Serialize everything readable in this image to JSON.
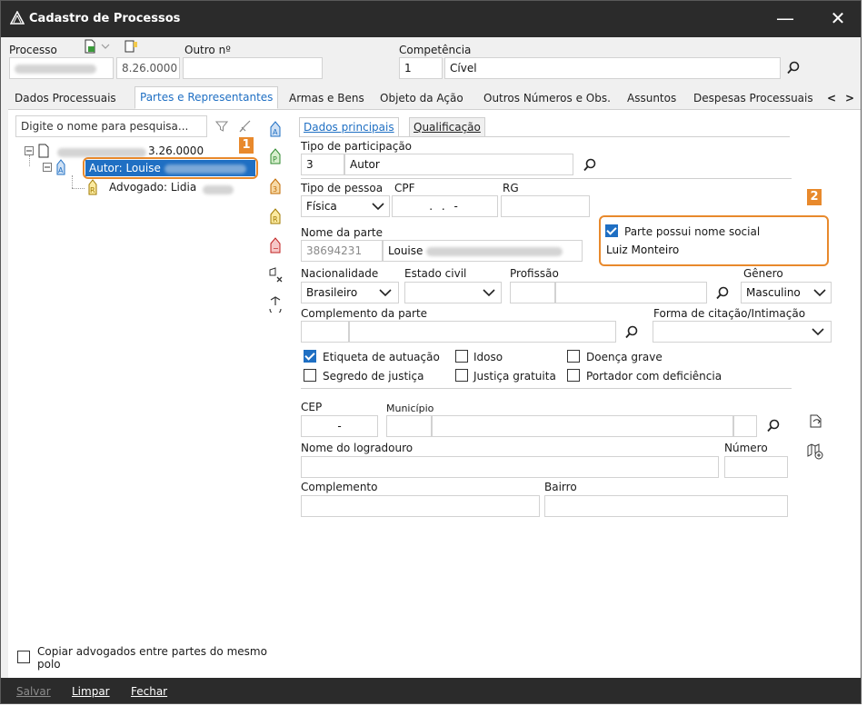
{
  "window": {
    "title": "Cadastro de Processos",
    "minimize": "—",
    "close": "✕"
  },
  "header": {
    "processo_label": "Processo",
    "processo_suffix": "8.26.0000",
    "outro_label": "Outro nº",
    "outro_value": "",
    "competencia_label": "Competência",
    "competencia_code": "1",
    "competencia_value": "Cível"
  },
  "tabs": [
    "Dados Processuais",
    "Partes e Representantes",
    "Armas e Bens",
    "Objeto da Ação",
    "Outros Números e Obs.",
    "Assuntos",
    "Despesas Processuais"
  ],
  "tab_nav": {
    "prev": "<",
    "next": ">"
  },
  "left": {
    "search_placeholder": "Digite o nome para pesquisa...",
    "tree_root_suffix": "3.26.0000",
    "tree_autor": "Autor: Louise",
    "tree_advogado": "Advogado: Lidia",
    "badge1": "1",
    "copy_checkbox_label": "Copiar advogados entre partes do mesmo polo",
    "copy_checked": false
  },
  "subtabs": {
    "dados_principais": "Dados principais",
    "qualificacao": "Qualificação"
  },
  "form": {
    "tipo_participacao_label": "Tipo de participação",
    "tipo_participacao_code": "3",
    "tipo_participacao_value": "Autor",
    "tipo_pessoa_label": "Tipo de pessoa",
    "tipo_pessoa_value": "Física",
    "cpf_label": "CPF",
    "cpf_value": ". . -",
    "rg_label": "RG",
    "rg_value": "",
    "nome_parte_label": "Nome da parte",
    "nome_parte_code": "38694231",
    "nome_parte_value": "Louise",
    "badge2": "2",
    "nome_social_checkbox_label": "Parte possui nome social",
    "nome_social_checked": true,
    "nome_social_value": "Luiz Monteiro",
    "nacionalidade_label": "Nacionalidade",
    "nacionalidade_value": "Brasileiro",
    "estado_civil_label": "Estado civil",
    "estado_civil_value": "",
    "profissao_label": "Profissão",
    "genero_label": "Gênero",
    "genero_value": "Masculino",
    "complemento_parte_label": "Complemento da parte",
    "forma_citacao_label": "Forma de citação/Intimação",
    "forma_citacao_value": "",
    "checks": {
      "etiqueta": {
        "label": "Etiqueta de autuação",
        "checked": true
      },
      "idoso": {
        "label": "Idoso",
        "checked": false
      },
      "doenca": {
        "label": "Doença grave",
        "checked": false
      },
      "segredo": {
        "label": "Segredo de justiça",
        "checked": false
      },
      "gratuita": {
        "label": "Justiça gratuita",
        "checked": false
      },
      "deficiencia": {
        "label": "Portador com deficiência",
        "checked": false
      }
    },
    "cep_label": "CEP",
    "cep_value": "-",
    "municipio_label": "Município",
    "logradouro_label": "Nome do logradouro",
    "numero_label": "Número",
    "complemento_label": "Complemento",
    "bairro_label": "Bairro"
  },
  "footer": {
    "salvar": "Salvar",
    "limpar": "Limpar",
    "fechar": "Fechar"
  },
  "colors": {
    "accent": "#1f6fc3",
    "highlight": "#e8892c",
    "titlebar": "#2b2b2b"
  }
}
